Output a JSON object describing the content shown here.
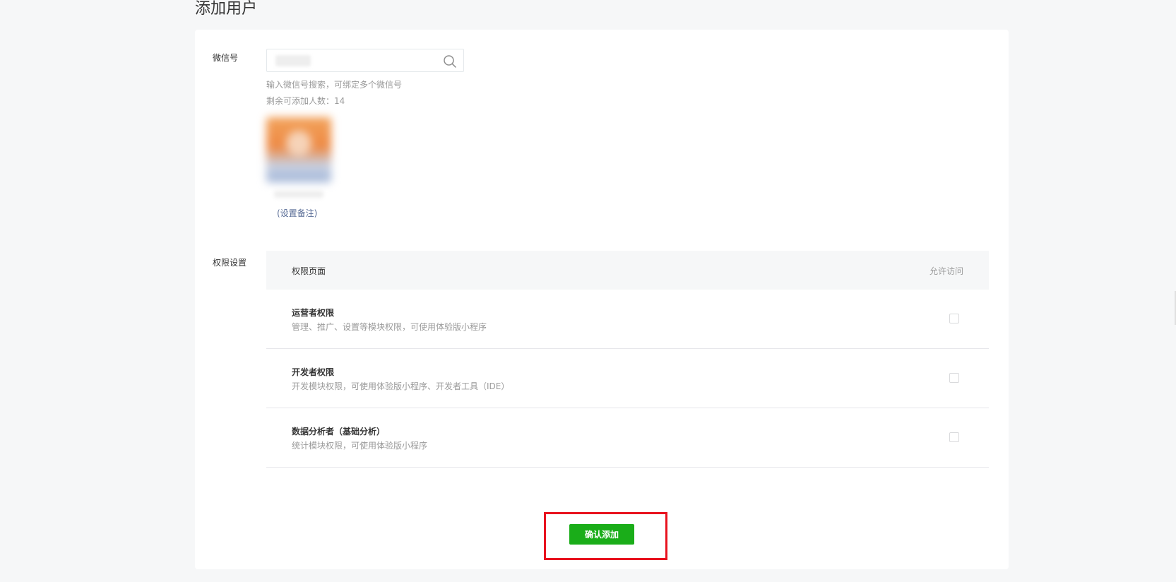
{
  "page": {
    "title": "添加用户"
  },
  "wechat_field": {
    "label": "微信号",
    "search_value": "",
    "hint": "输入微信号搜索，可绑定多个微信号",
    "remaining": "剩余可添加人数：14",
    "remark_link": "(设置备注)"
  },
  "permissions": {
    "label": "权限设置",
    "header_page": "权限页面",
    "header_allow": "允许访问",
    "rows": [
      {
        "name": "运营者权限",
        "desc": "管理、推广、设置等模块权限，可使用体验版小程序",
        "checked": false
      },
      {
        "name": "开发者权限",
        "desc": "开发模块权限，可使用体验版小程序、开发者工具（IDE）",
        "checked": false
      },
      {
        "name": "数据分析者（基础分析）",
        "desc": "统计模块权限，可使用体验版小程序",
        "checked": false
      }
    ]
  },
  "actions": {
    "confirm_label": "确认添加"
  },
  "icons": {
    "search": "search-icon"
  },
  "colors": {
    "primary": "#1aad19",
    "link": "#576b95",
    "highlight": "#e8121e"
  }
}
